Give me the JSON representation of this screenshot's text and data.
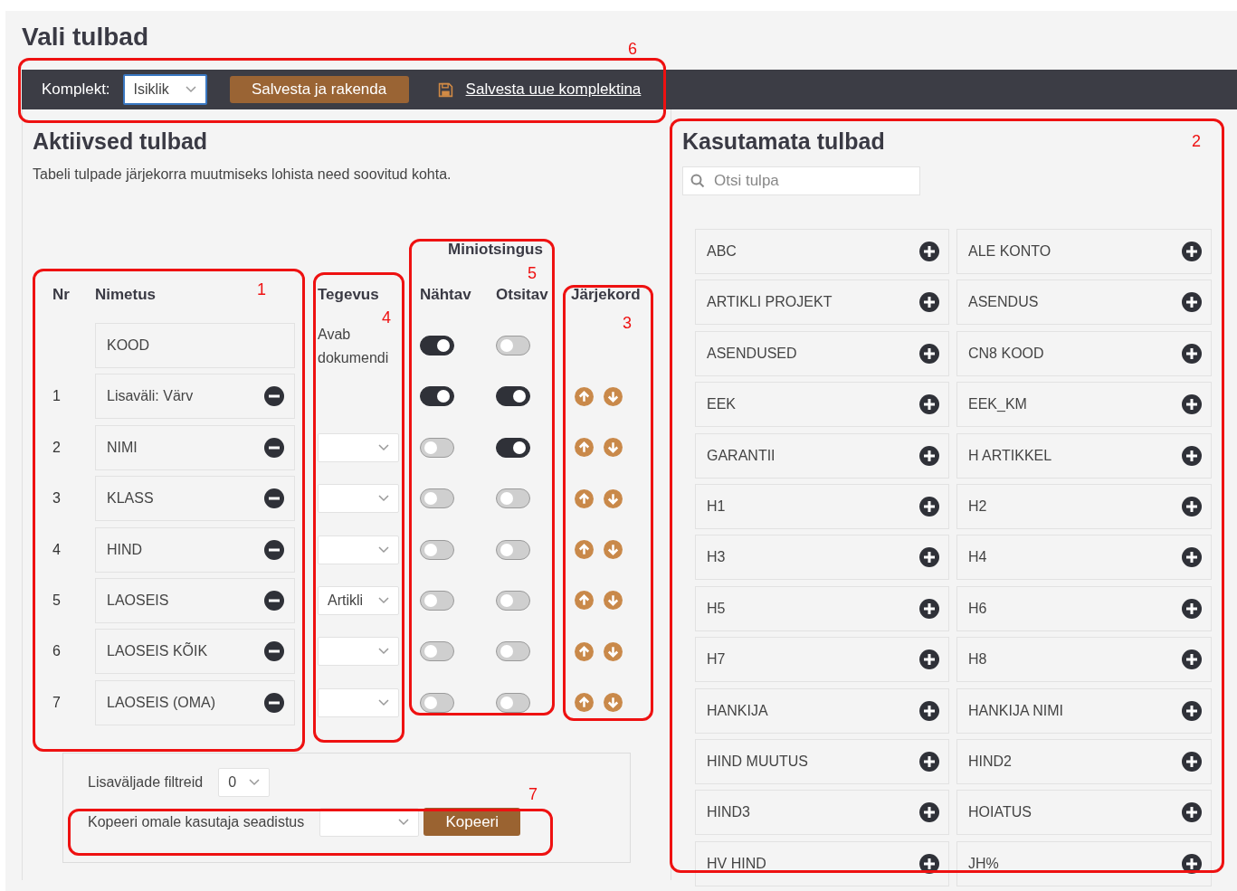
{
  "title": "Vali tulbad",
  "toolbar": {
    "set_label": "Komplekt:",
    "set_value": "Isiklik",
    "apply_button": "Salvesta ja rakenda",
    "save_link": "Salvesta uue komplektina"
  },
  "active": {
    "heading": "Aktiivsed tulbad",
    "description": "Tabeli tulpade järjekorra muutmiseks lohista need soovitud kohta.",
    "group_header": "Miniotsingus",
    "columns": [
      "Nr",
      "Nimetus",
      "Tegevus",
      "Nähtav",
      "Otsitav",
      "Järjekord"
    ],
    "rows": [
      {
        "name": "KOOD",
        "removable": false,
        "action": {
          "kind": "text",
          "text": "Avab dokumendi"
        },
        "visible": true,
        "searchable": false,
        "reorder": false
      },
      {
        "nr": "1",
        "name": "Lisaväli: Värv",
        "removable": true,
        "action": {
          "kind": "none"
        },
        "visible": true,
        "searchable": true,
        "reorder": true
      },
      {
        "nr": "2",
        "name": "NIMI",
        "removable": true,
        "action": {
          "kind": "select"
        },
        "visible": false,
        "searchable": true,
        "reorder": true
      },
      {
        "nr": "3",
        "name": "KLASS",
        "removable": true,
        "action": {
          "kind": "select"
        },
        "visible": false,
        "searchable": false,
        "reorder": true
      },
      {
        "nr": "4",
        "name": "HIND",
        "removable": true,
        "action": {
          "kind": "select"
        },
        "visible": false,
        "searchable": false,
        "reorder": true
      },
      {
        "nr": "5",
        "name": "LAOSEIS",
        "removable": true,
        "action": {
          "kind": "select",
          "value": "Artikli"
        },
        "visible": false,
        "searchable": false,
        "reorder": true
      },
      {
        "nr": "6",
        "name": "LAOSEIS KÕIK",
        "removable": true,
        "action": {
          "kind": "select"
        },
        "visible": false,
        "searchable": false,
        "reorder": true
      },
      {
        "nr": "7",
        "name": "LAOSEIS (OMA)",
        "removable": true,
        "action": {
          "kind": "select"
        },
        "visible": false,
        "searchable": false,
        "reorder": true
      }
    ],
    "filters_label": "Lisaväljade filtreid",
    "filters_value": "0",
    "copy_label": "Kopeeri omale kasutaja seadistus",
    "copy_button": "Kopeeri"
  },
  "unused": {
    "heading": "Kasutamata tulbad",
    "search_placeholder": "Otsi tulpa",
    "items": [
      "ABC",
      "ALE KONTO",
      "ARTIKLI PROJEKT",
      "ASENDUS",
      "ASENDUSED",
      "CN8 KOOD",
      "EEK",
      "EEK_KM",
      "GARANTII",
      "H ARTIKKEL",
      "H1",
      "H2",
      "H3",
      "H4",
      "H5",
      "H6",
      "H7",
      "H8",
      "HANKIJA",
      "HANKIJA NIMI",
      "HIND MUUTUS",
      "HIND2",
      "HIND3",
      "HOIATUS",
      "HV HIND",
      "JH%"
    ]
  },
  "annotations": [
    {
      "label": "6"
    },
    {
      "label": "1"
    },
    {
      "label": "4"
    },
    {
      "label": "5"
    },
    {
      "label": "3"
    },
    {
      "label": "2"
    },
    {
      "label": "7"
    }
  ]
}
